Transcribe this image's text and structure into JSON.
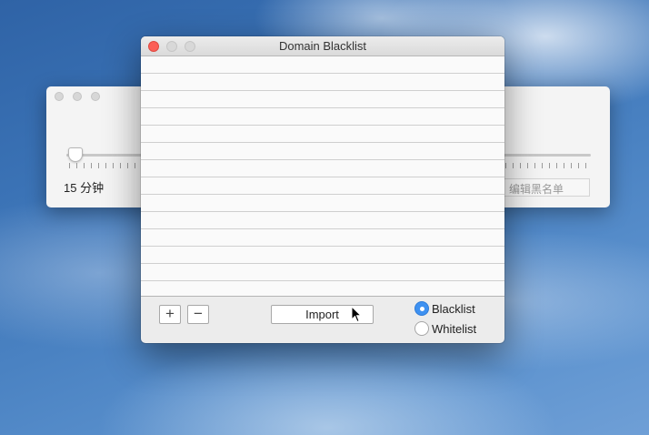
{
  "background_window": {
    "duration_label": "15 分钟",
    "edit_blacklist_placeholder": "编辑黑名单"
  },
  "dialog": {
    "title": "Domain Blacklist",
    "rows": [
      "",
      "",
      "",
      "",
      "",
      "",
      "",
      "",
      "",
      "",
      "",
      "",
      "",
      ""
    ],
    "add_symbol": "+",
    "remove_symbol": "−",
    "import_label": "Import",
    "mode_options": [
      {
        "label": "Blacklist",
        "selected": true
      },
      {
        "label": "Whitelist",
        "selected": false
      }
    ]
  },
  "colors": {
    "accent": "#3e91f1",
    "close": "#fc5f57"
  }
}
